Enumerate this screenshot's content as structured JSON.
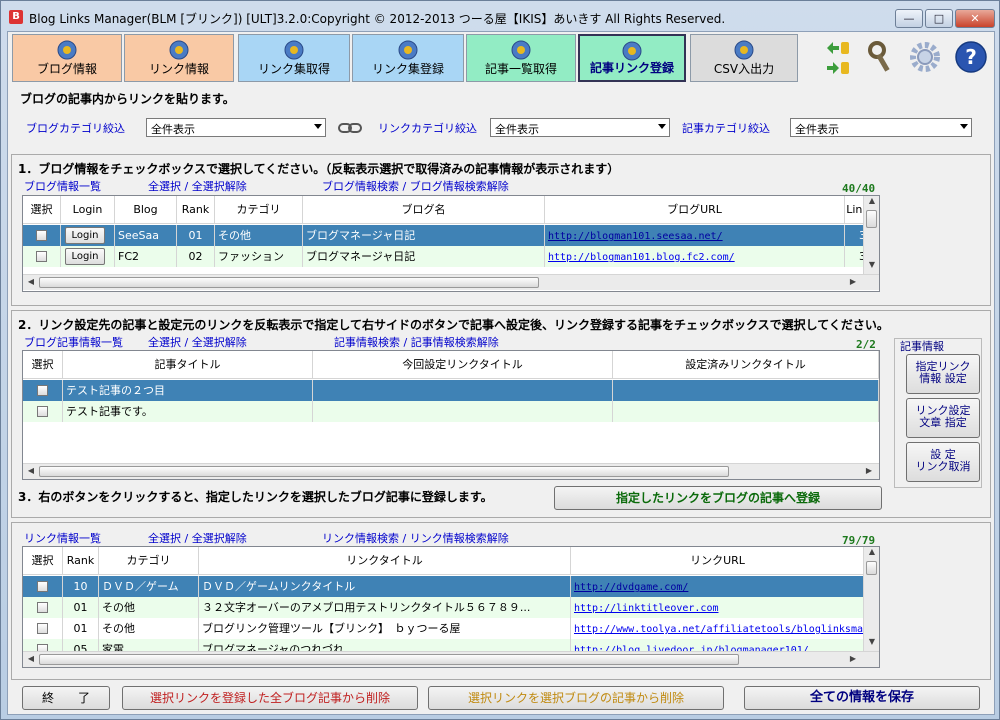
{
  "window": {
    "title": "Blog Links Manager(BLM [ブリンク]) [ULT]3.2.0:Copyright © 2012-2013 つーる屋【IKIS】あいきす All Rights Reserved.",
    "app_icon": "B",
    "minimize": "—",
    "maximize": "□",
    "close": "✕"
  },
  "tabs": [
    {
      "label": "ブログ情報",
      "color": "#f9c9a5",
      "icon": "users-icon"
    },
    {
      "label": "リンク情報",
      "color": "#f9c9a5",
      "icon": "globe-icon"
    },
    {
      "label": "リンク集取得",
      "color": "#a9d6f5",
      "icon": "globe-download-icon"
    },
    {
      "label": "リンク集登録",
      "color": "#a9d6f5",
      "icon": "globe-upload-icon"
    },
    {
      "label": "記事一覧取得",
      "color": "#92ecc4",
      "icon": "article-download-icon"
    },
    {
      "label": "記事リンク登録",
      "color": "#92ecc4",
      "icon": "article-link-icon"
    },
    {
      "label": "CSV入出力",
      "color": "#dcdcdc",
      "icon": "csv-icon"
    }
  ],
  "instruction": "ブログの記事内からリンクを貼ります。",
  "filters": {
    "blog_category_label": "ブログカテゴリ絞込",
    "blog_category_value": "全件表示",
    "link_category_label": "リンクカテゴリ絞込",
    "link_category_value": "全件表示",
    "article_category_label": "記事カテゴリ絞込",
    "article_category_value": "全件表示"
  },
  "section1": {
    "heading": "1．ブログ情報をチェックボックスで選択してください。（反転表示選択で取得済みの記事情報が表示されます）",
    "list_link": "ブログ情報一覧",
    "select_all": "全選択 / 全選択解除",
    "search": "ブログ情報検索 / ブログ情報検索解除",
    "count": "40/40",
    "columns": [
      "選択",
      "Login",
      "Blog",
      "Rank",
      "カテゴリ",
      "ブログ名",
      "ブログURL",
      "Link"
    ],
    "rows": [
      {
        "login": "Login",
        "blog": "SeeSaa",
        "rank": "01",
        "category": "その他",
        "name": "ブログマネージャ日記",
        "url": "http://blogman101.seesaa.net/",
        "link": "3",
        "extra": "b"
      },
      {
        "login": "Login",
        "blog": "FC2",
        "rank": "02",
        "category": "ファッション",
        "name": "ブログマネージャ日記",
        "url": "http://blogman101.blog.fc2.com/",
        "link": "3",
        "extra": "b"
      }
    ]
  },
  "section2": {
    "heading": "2．リンク設定先の記事と設定元のリンクを反転表示で指定して右サイドのボタンで記事へ設定後、リンク登録する記事をチェックボックスで選択してください。",
    "list_link": "ブログ記事情報一覧",
    "select_all": "全選択 / 全選択解除",
    "search": "記事情報検索 / 記事情報検索解除",
    "count": "2/2",
    "columns": [
      "選択",
      "記事タイトル",
      "今回設定リンクタイトル",
      "設定済みリンクタイトル"
    ],
    "rows": [
      {
        "title": "テスト記事の２つ目",
        "current": "",
        "set": ""
      },
      {
        "title": "テスト記事です。",
        "current": "",
        "set": ""
      }
    ],
    "side_group": "記事情報",
    "side_buttons": [
      [
        "指定リンク",
        "情報 設定"
      ],
      [
        "リンク設定",
        "文章 指定"
      ],
      [
        "設 定",
        "リンク取消"
      ]
    ]
  },
  "section3": {
    "heading": "3．右のボタンをクリックすると、指定したリンクを選択したブログ記事に登録します。",
    "register_button": "指定したリンクをブログの記事へ登録"
  },
  "section4": {
    "list_link": "リンク情報一覧",
    "select_all": "全選択 / 全選択解除",
    "search": "リンク情報検索 / リンク情報検索解除",
    "count": "79/79",
    "columns": [
      "選択",
      "Rank",
      "カテゴリ",
      "リンクタイトル",
      "リンクURL"
    ],
    "rows": [
      {
        "rank": "10",
        "category": "ＤＶＤ／ゲーム",
        "title": "ＤＶＤ／ゲームリンクタイトル",
        "url": "http://dvdgame.com/"
      },
      {
        "rank": "01",
        "category": "その他",
        "title": "３２文字オーバーのアメブロ用テストリンクタイトル５６７８９...",
        "url": "http://linktitleover.com"
      },
      {
        "rank": "01",
        "category": "その他",
        "title": "ブログリンク管理ツール【ブリンク】　ｂｙつーる屋",
        "url": "http://www.toolya.net/affiliatetools/bloglinksmar"
      },
      {
        "rank": "05",
        "category": "家電",
        "title": "ブログマネージャのつれづれ",
        "url": "http://blog.livedoor.jp/blogmanager101/"
      }
    ]
  },
  "footer": {
    "exit": "終　　了",
    "delete_all": "選択リンクを登録した全ブログ記事から削除",
    "delete_selected": "選択リンクを選択ブログの記事から削除",
    "save_all": "全ての情報を保存"
  },
  "colors": {
    "accent_blue": "#3f82b5",
    "count_green": "#1e7a1e",
    "link_blue": "#0000cc",
    "delete_red": "#c02020",
    "delete_gold": "#c08a10",
    "save_navy": "#000080"
  }
}
